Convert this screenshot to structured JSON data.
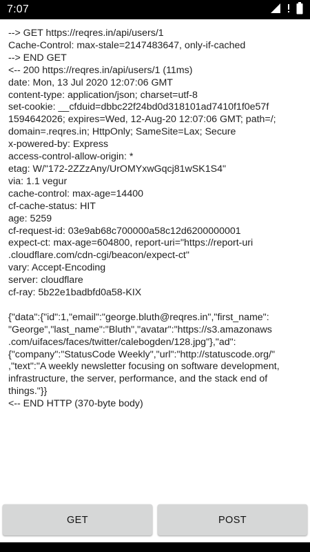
{
  "status_bar": {
    "time": "7:07",
    "icons": [
      "signal-icon",
      "no-wifi-indicator-icon",
      "battery-icon"
    ]
  },
  "log": {
    "lines": [
      "--> GET https://reqres.in/api/users/1",
      "Cache-Control: max-stale=2147483647, only-if-cached",
      "--> END GET",
      "<-- 200 https://reqres.in/api/users/1 (11ms)",
      "date: Mon, 13 Jul 2020 12:07:06 GMT",
      "content-type: application/json; charset=utf-8",
      "set-cookie: __cfduid=dbbc22f24bd0d318101ad7410f1f0e57f",
      "1594642026; expires=Wed, 12-Aug-20 12:07:06 GMT; path=/;",
      "domain=.reqres.in; HttpOnly; SameSite=Lax; Secure",
      "x-powered-by: Express",
      "access-control-allow-origin: *",
      "etag: W/\"172-2ZZzAny/UrOMYxwGqcj81wSK1S4\"",
      "via: 1.1 vegur",
      "cache-control: max-age=14400",
      "cf-cache-status: HIT",
      "age: 5259",
      "cf-request-id: 03e9ab68c700000a58c12d6200000001",
      "expect-ct: max-age=604800, report-uri=\"https://report-uri",
      ".cloudflare.com/cdn-cgi/beacon/expect-ct\"",
      "vary: Accept-Encoding",
      "server: cloudflare",
      "cf-ray: 5b22e1badbfd0a58-KIX",
      "",
      "{\"data\":{\"id\":1,\"email\":\"george.bluth@reqres.in\",\"first_name\":",
      "\"George\",\"last_name\":\"Bluth\",\"avatar\":\"https://s3.amazonaws",
      ".com/uifaces/faces/twitter/calebogden/128.jpg\"},\"ad\":",
      "{\"company\":\"StatusCode Weekly\",\"url\":\"http://statuscode.org/\"",
      ",\"text\":\"A weekly newsletter focusing on software development,",
      "infrastructure, the server, performance, and the stack end of",
      "things.\"}}",
      "<-- END HTTP (370-byte body)"
    ]
  },
  "buttons": {
    "get_label": "GET",
    "post_label": "POST"
  }
}
